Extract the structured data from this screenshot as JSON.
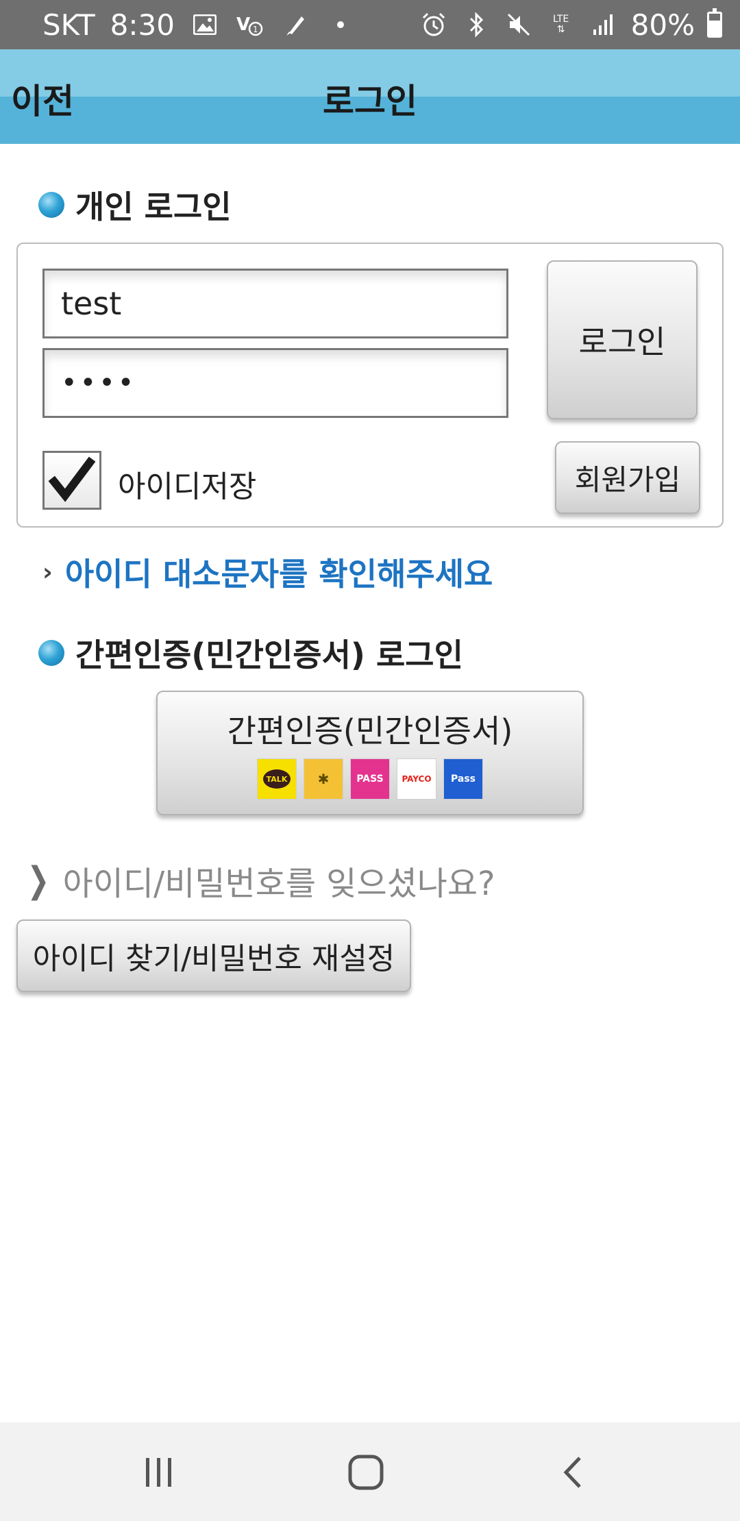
{
  "status_bar": {
    "carrier": "SKT",
    "time": "8:30",
    "network": "LTE",
    "battery": "80%",
    "icons_left": [
      "image-icon",
      "volte-icon",
      "pen-icon",
      "dot-icon"
    ],
    "icons_right": [
      "alarm-icon",
      "bluetooth-icon",
      "mute-icon",
      "lte-icon",
      "signal-icon",
      "battery-icon"
    ]
  },
  "header": {
    "back_label": "이전",
    "title": "로그인"
  },
  "personal_login": {
    "section_title": "개인 로그인",
    "id_value": "test",
    "password_value": "••••",
    "login_button": "로그인",
    "save_id_label": "아이디저장",
    "save_id_checked": true,
    "signup_button": "회원가입"
  },
  "notice": {
    "text": "아이디 대소문자를 확인해주세요"
  },
  "simple_auth": {
    "section_title": "간편인증(민간인증서) 로그인",
    "button_label": "간편인증(민간인증서)",
    "providers": [
      {
        "name": "kakao-icon",
        "text": "TALK"
      },
      {
        "name": "kb-sign-icon",
        "text": "✱"
      },
      {
        "name": "pass-icon",
        "text": "PASS"
      },
      {
        "name": "payco-icon",
        "text": "PAYCO"
      },
      {
        "name": "samsung-pass-icon",
        "text": "Pass"
      }
    ]
  },
  "recovery": {
    "question": "아이디/비밀번호를 잊으셨나요?",
    "find_button": "아이디 찾기/비밀번호 재설정"
  },
  "colors": {
    "header_top": "#84cbe6",
    "header_bottom": "#55b3d9",
    "notice_blue": "#1d74c2",
    "status_bar": "#6f6f6f"
  }
}
